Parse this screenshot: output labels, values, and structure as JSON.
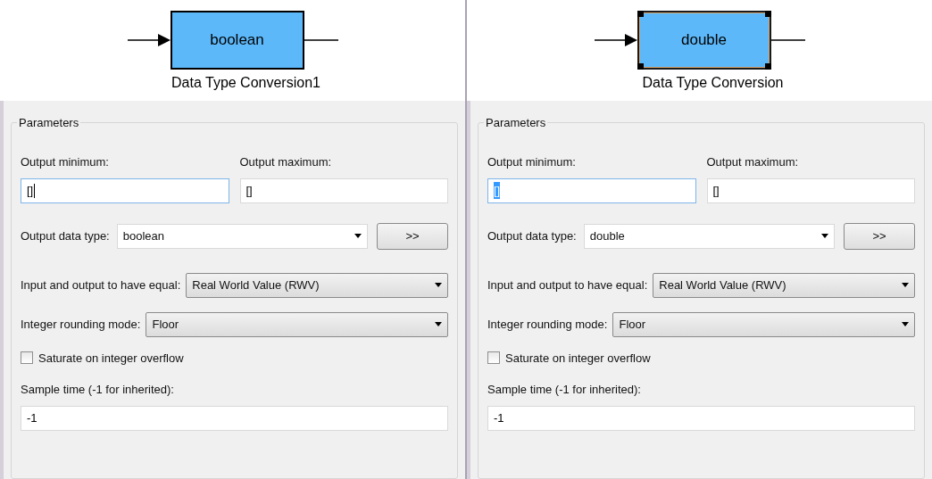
{
  "panels": [
    {
      "block": {
        "value": "boolean",
        "name": "Data Type Conversion1",
        "selected": false
      },
      "group_title": "Parameters",
      "output_minimum": {
        "label": "Output minimum:",
        "value": "[]",
        "focused": true,
        "text_selected": false
      },
      "output_maximum": {
        "label": "Output maximum:",
        "value": "[]",
        "focused": false,
        "text_selected": false
      },
      "output_data_type": {
        "label": "Output data type:",
        "value": "boolean",
        "kind": "combo",
        "button": ">>"
      },
      "input_output_equal": {
        "label": "Input and output to have equal:",
        "value": "Real World Value (RWV)",
        "kind": "select"
      },
      "rounding_mode": {
        "label": "Integer rounding mode:",
        "value": "Floor",
        "kind": "select"
      },
      "saturate": {
        "label": "Saturate on integer overflow",
        "checked": false
      },
      "sample_time": {
        "label": "Sample time (-1 for inherited):",
        "value": "-1",
        "focused": false,
        "text_selected": false
      }
    },
    {
      "block": {
        "value": "double",
        "name": "Data Type Conversion",
        "selected": true
      },
      "group_title": "Parameters",
      "output_minimum": {
        "label": "Output minimum:",
        "value": "[]",
        "focused": true,
        "text_selected": true
      },
      "output_maximum": {
        "label": "Output maximum:",
        "value": "[]",
        "focused": false,
        "text_selected": false
      },
      "output_data_type": {
        "label": "Output data type:",
        "value": "double",
        "kind": "combo",
        "button": ">>"
      },
      "input_output_equal": {
        "label": "Input and output to have equal:",
        "value": "Real World Value (RWV)",
        "kind": "select"
      },
      "rounding_mode": {
        "label": "Integer rounding mode:",
        "value": "Floor",
        "kind": "select"
      },
      "saturate": {
        "label": "Saturate on integer overflow",
        "checked": false
      },
      "sample_time": {
        "label": "Sample time (-1 for inherited):",
        "value": "-1",
        "focused": false,
        "text_selected": false
      }
    }
  ]
}
